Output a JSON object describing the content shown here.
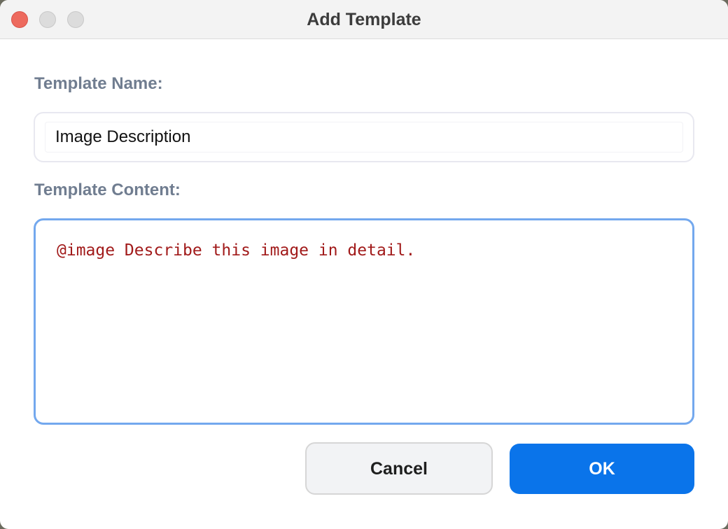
{
  "window": {
    "title": "Add Template"
  },
  "form": {
    "name_label": "Template Name:",
    "name_value": "Image Description",
    "content_label": "Template Content:",
    "content_value": "@image Describe this image in detail."
  },
  "buttons": {
    "cancel_label": "Cancel",
    "ok_label": "OK"
  },
  "colors": {
    "accent": "#0a74ea",
    "focus_ring": "#73a8ee",
    "label": "#707d90",
    "content_text": "#a11a1a",
    "close_button": "#ed6a5e"
  }
}
